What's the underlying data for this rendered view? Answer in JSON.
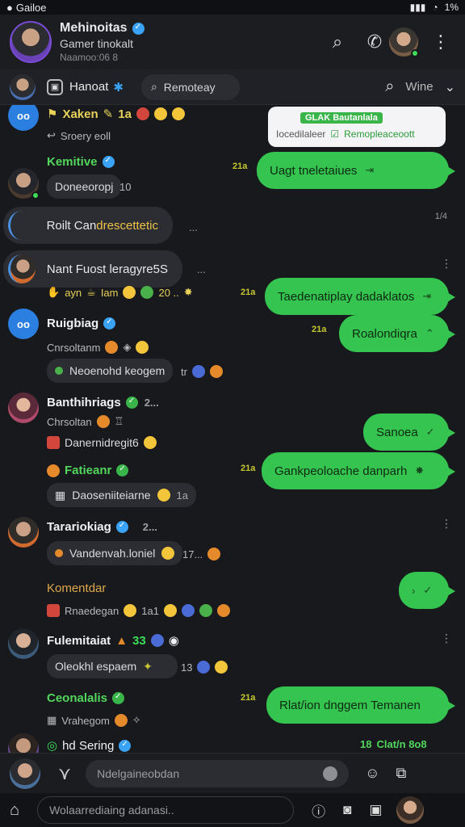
{
  "statusbar": {
    "carrier": "Gailoe",
    "battery": "1%"
  },
  "header": {
    "name": "Mehinoitas",
    "subtitle": "Gamer tinokalt",
    "meta": "Naamoo:06 8"
  },
  "subbar": {
    "label": "Hanoat",
    "search_placeholder": "Remoteay",
    "view": "Wine"
  },
  "card": {
    "badge": "GLAK Bautanlala",
    "line_left": "Iocedilaleer",
    "line_right": "Remopleaceoott"
  },
  "messages": [
    {
      "user": "Xaken",
      "extra": "1a",
      "sub": "Sroery eoll"
    },
    {
      "user": "Kemitive",
      "pill": "Doneeoropj",
      "pill_after": "10",
      "bubble": "Uagt tneletaiues"
    },
    {
      "wide": "Roilt Candrescettetic",
      "wide_hl": "drescettetic",
      "wide_pre": "Roilt Can",
      "dots": "...",
      "side": "1/4"
    },
    {
      "wide": "Nant Fuost leragyre5S",
      "dots": "...",
      "line": "ayn",
      "line2": "Iam",
      "line3": "20 ..",
      "bubble": "Taedenatiplay dadaklatos"
    },
    {
      "user": "Ruigbiag",
      "sub": "Cnrsoltanm",
      "pill": "Neoenohd keogem",
      "pill_after": "tr",
      "bubble": "Roalondiqra"
    },
    {
      "user": "Banthihriags",
      "sub": "Chrsoltan",
      "pill": "Danernidregit6",
      "bubble": "Sanoea"
    },
    {
      "user": "Fatieanr",
      "pill": "Daoseniiteiarne",
      "pill_after": "1a",
      "bubble": "Gankpeoloache danparh"
    },
    {
      "user": "Tarariokiag",
      "pill": "Vandenvah.loniel",
      "pill_after": "17..."
    },
    {
      "user": "Komentdar",
      "sub": "Rnaedegan",
      "sub_after": "1a1"
    },
    {
      "user": "Fulemitaiat",
      "extra": "33",
      "pill": "Oleokhl espaem",
      "pill_after": "13"
    },
    {
      "user": "Ceonalalis",
      "sub": "Vrahegom",
      "bubble": "Rlat/ion dnggem Temanen"
    },
    {
      "user": "hd  Sering",
      "right": "Clat/n 8o8",
      "right_n": "18"
    }
  ],
  "timestamps": [
    "21a",
    "21a",
    "21a",
    "21a"
  ],
  "composer": {
    "placeholder": "Ndelgaineobdan"
  },
  "bottombar": {
    "placeholder": "Wolaarrediaing adanasi.."
  }
}
